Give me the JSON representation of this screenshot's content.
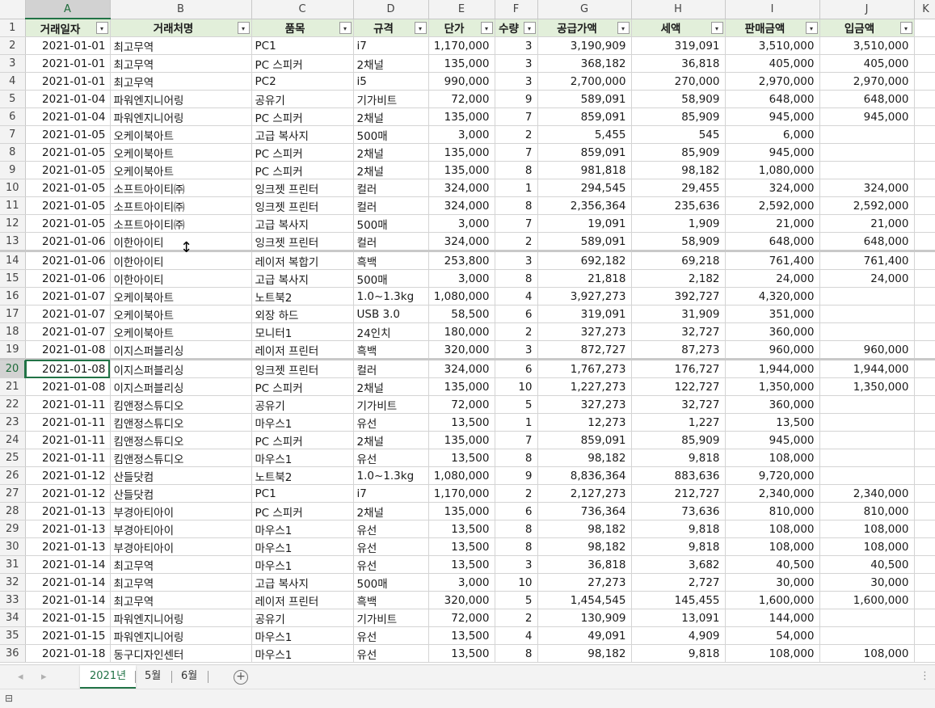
{
  "columns": [
    "A",
    "B",
    "C",
    "D",
    "E",
    "F",
    "G",
    "H",
    "I",
    "J",
    "K"
  ],
  "headers": [
    "거래일자",
    "거래처명",
    "품목",
    "규격",
    "단가",
    "수량",
    "공급가액",
    "세액",
    "판매금액",
    "입금액"
  ],
  "header_row_number": "1",
  "rows": [
    [
      "2",
      "2021-01-01",
      "최고무역",
      "PC1",
      "i7",
      "1,170,000",
      "3",
      "3,190,909",
      "319,091",
      "3,510,000",
      "3,510,000"
    ],
    [
      "3",
      "2021-01-01",
      "최고무역",
      "PC 스피커",
      "2채널",
      "135,000",
      "3",
      "368,182",
      "36,818",
      "405,000",
      "405,000"
    ],
    [
      "4",
      "2021-01-01",
      "최고무역",
      "PC2",
      "i5",
      "990,000",
      "3",
      "2,700,000",
      "270,000",
      "2,970,000",
      "2,970,000"
    ],
    [
      "5",
      "2021-01-04",
      "파워엔지니어링",
      "공유기",
      "기가비트",
      "72,000",
      "9",
      "589,091",
      "58,909",
      "648,000",
      "648,000"
    ],
    [
      "6",
      "2021-01-04",
      "파워엔지니어링",
      "PC 스피커",
      "2채널",
      "135,000",
      "7",
      "859,091",
      "85,909",
      "945,000",
      "945,000"
    ],
    [
      "7",
      "2021-01-05",
      "오케이북아트",
      "고급 복사지",
      "500매",
      "3,000",
      "2",
      "5,455",
      "545",
      "6,000",
      ""
    ],
    [
      "8",
      "2021-01-05",
      "오케이북아트",
      "PC 스피커",
      "2채널",
      "135,000",
      "7",
      "859,091",
      "85,909",
      "945,000",
      ""
    ],
    [
      "9",
      "2021-01-05",
      "오케이북아트",
      "PC 스피커",
      "2채널",
      "135,000",
      "8",
      "981,818",
      "98,182",
      "1,080,000",
      ""
    ],
    [
      "10",
      "2021-01-05",
      "소프트아이티㈜",
      "잉크젯 프린터",
      "컬러",
      "324,000",
      "1",
      "294,545",
      "29,455",
      "324,000",
      "324,000"
    ],
    [
      "11",
      "2021-01-05",
      "소프트아이티㈜",
      "잉크젯 프린터",
      "컬러",
      "324,000",
      "8",
      "2,356,364",
      "235,636",
      "2,592,000",
      "2,592,000"
    ],
    [
      "12",
      "2021-01-05",
      "소프트아이티㈜",
      "고급 복사지",
      "500매",
      "3,000",
      "7",
      "19,091",
      "1,909",
      "21,000",
      "21,000"
    ],
    [
      "13",
      "2021-01-06",
      "이한아이티",
      "잉크젯 프린터",
      "컬러",
      "324,000",
      "2",
      "589,091",
      "58,909",
      "648,000",
      "648,000"
    ],
    [
      "14",
      "2021-01-06",
      "이한아이티",
      "레이저 복합기",
      "흑백",
      "253,800",
      "3",
      "692,182",
      "69,218",
      "761,400",
      "761,400"
    ],
    [
      "15",
      "2021-01-06",
      "이한아이티",
      "고급 복사지",
      "500매",
      "3,000",
      "8",
      "21,818",
      "2,182",
      "24,000",
      "24,000"
    ],
    [
      "16",
      "2021-01-07",
      "오케이북아트",
      "노트북2",
      "1.0~1.3kg",
      "1,080,000",
      "4",
      "3,927,273",
      "392,727",
      "4,320,000",
      ""
    ],
    [
      "17",
      "2021-01-07",
      "오케이북아트",
      "외장 하드",
      "USB 3.0",
      "58,500",
      "6",
      "319,091",
      "31,909",
      "351,000",
      ""
    ],
    [
      "18",
      "2021-01-07",
      "오케이북아트",
      "모니터1",
      "24인치",
      "180,000",
      "2",
      "327,273",
      "32,727",
      "360,000",
      ""
    ],
    [
      "19",
      "2021-01-08",
      "이지스퍼블리싱",
      "레이저 프린터",
      "흑백",
      "320,000",
      "3",
      "872,727",
      "87,273",
      "960,000",
      "960,000"
    ],
    [
      "20",
      "2021-01-08",
      "이지스퍼블리싱",
      "잉크젯 프린터",
      "컬러",
      "324,000",
      "6",
      "1,767,273",
      "176,727",
      "1,944,000",
      "1,944,000"
    ],
    [
      "21",
      "2021-01-08",
      "이지스퍼블리싱",
      "PC 스피커",
      "2채널",
      "135,000",
      "10",
      "1,227,273",
      "122,727",
      "1,350,000",
      "1,350,000"
    ],
    [
      "22",
      "2021-01-11",
      "킴앤정스튜디오",
      "공유기",
      "기가비트",
      "72,000",
      "5",
      "327,273",
      "32,727",
      "360,000",
      ""
    ],
    [
      "23",
      "2021-01-11",
      "킴앤정스튜디오",
      "마우스1",
      "유선",
      "13,500",
      "1",
      "12,273",
      "1,227",
      "13,500",
      ""
    ],
    [
      "24",
      "2021-01-11",
      "킴앤정스튜디오",
      "PC 스피커",
      "2채널",
      "135,000",
      "7",
      "859,091",
      "85,909",
      "945,000",
      ""
    ],
    [
      "25",
      "2021-01-11",
      "킴앤정스튜디오",
      "마우스1",
      "유선",
      "13,500",
      "8",
      "98,182",
      "9,818",
      "108,000",
      ""
    ],
    [
      "26",
      "2021-01-12",
      "산들닷컴",
      "노트북2",
      "1.0~1.3kg",
      "1,080,000",
      "9",
      "8,836,364",
      "883,636",
      "9,720,000",
      ""
    ],
    [
      "27",
      "2021-01-12",
      "산들닷컴",
      "PC1",
      "i7",
      "1,170,000",
      "2",
      "2,127,273",
      "212,727",
      "2,340,000",
      "2,340,000"
    ],
    [
      "28",
      "2021-01-13",
      "부경아티아이",
      "PC 스피커",
      "2채널",
      "135,000",
      "6",
      "736,364",
      "73,636",
      "810,000",
      "810,000"
    ],
    [
      "29",
      "2021-01-13",
      "부경아티아이",
      "마우스1",
      "유선",
      "13,500",
      "8",
      "98,182",
      "9,818",
      "108,000",
      "108,000"
    ],
    [
      "30",
      "2021-01-13",
      "부경아티아이",
      "마우스1",
      "유선",
      "13,500",
      "8",
      "98,182",
      "9,818",
      "108,000",
      "108,000"
    ],
    [
      "31",
      "2021-01-14",
      "최고무역",
      "마우스1",
      "유선",
      "13,500",
      "3",
      "36,818",
      "3,682",
      "40,500",
      "40,500"
    ],
    [
      "32",
      "2021-01-14",
      "최고무역",
      "고급 복사지",
      "500매",
      "3,000",
      "10",
      "27,273",
      "2,727",
      "30,000",
      "30,000"
    ],
    [
      "33",
      "2021-01-14",
      "최고무역",
      "레이저 프린터",
      "흑백",
      "320,000",
      "5",
      "1,454,545",
      "145,455",
      "1,600,000",
      "1,600,000"
    ],
    [
      "34",
      "2021-01-15",
      "파워엔지니어링",
      "공유기",
      "기가비트",
      "72,000",
      "2",
      "130,909",
      "13,091",
      "144,000",
      ""
    ],
    [
      "35",
      "2021-01-15",
      "파워엔지니어링",
      "마우스1",
      "유선",
      "13,500",
      "4",
      "49,091",
      "4,909",
      "54,000",
      ""
    ],
    [
      "36",
      "2021-01-18",
      "동구디자인센터",
      "마우스1",
      "유선",
      "13,500",
      "8",
      "98,182",
      "9,818",
      "108,000",
      "108,000"
    ]
  ],
  "sheet_tabs": [
    "2021년",
    "5월",
    "6월"
  ],
  "active_tab": "2021년",
  "add_sheet_symbol": "+",
  "nav_prev": "◂",
  "nav_next": "▸",
  "tabbar_more": "⋮",
  "filter_symbol": "▾",
  "status_icon": "⊟",
  "resize_cursor": "↕",
  "selected_column": "A",
  "selected_row": "20",
  "colors": {
    "header_fill": "#e2efda",
    "accent": "#217346"
  }
}
